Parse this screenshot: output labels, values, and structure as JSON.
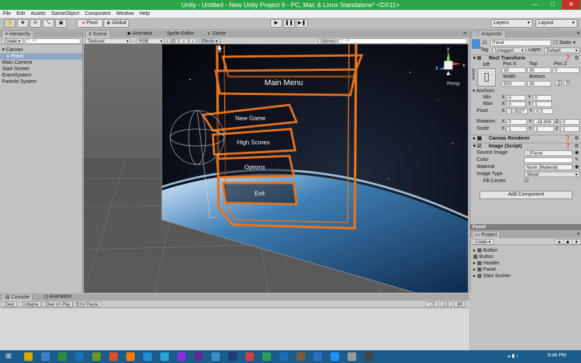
{
  "window": {
    "title": "Unity - Untitled - New Unity Project 9 - PC, Mac & Linux Standalone* <DX11>",
    "minimize": "—",
    "maximize": "□",
    "close": "✕"
  },
  "menu": [
    "File",
    "Edit",
    "Assets",
    "GameObject",
    "Component",
    "Window",
    "Help"
  ],
  "toolbar": {
    "pivot": "Pivot",
    "global": "Global",
    "play": "▶",
    "pause": "❚❚",
    "step": "▶❚",
    "layers": "Layers",
    "layout": "Layout"
  },
  "hierarchy": {
    "tab": "Hierarchy",
    "create": "Create",
    "search": "All",
    "items": [
      {
        "label": "Canvas",
        "indent": 0,
        "selected": false
      },
      {
        "label": "Panel",
        "indent": 1,
        "selected": true
      },
      {
        "label": "Main Camera",
        "indent": 0,
        "selected": false
      },
      {
        "label": "Start Screen",
        "indent": 0,
        "selected": false
      },
      {
        "label": "EventSystem",
        "indent": 0,
        "selected": false
      },
      {
        "label": "Particle System",
        "indent": 0,
        "selected": false
      }
    ]
  },
  "scene": {
    "tabs": [
      "Scene",
      "Animator",
      "Sprite Editor",
      "Game"
    ],
    "shading": "Textured",
    "render": "RGB",
    "mode2d": "2D",
    "effects": "Effects",
    "gizmos": "Gizmos",
    "search": "All",
    "persp": "Persp",
    "buttons": [
      "New Game",
      "High Scores",
      "Options",
      "Exit"
    ],
    "header": "Main Menu"
  },
  "inspector": {
    "tab": "Inspector",
    "object": "Panel",
    "static": "Static",
    "tag_label": "Tag",
    "tag": "Untagged",
    "layer_label": "Layer",
    "layer": "Default",
    "rect": {
      "title": "Rect Transform",
      "anchor_preset": "left",
      "stretch": "stretch",
      "posx_l": "Pos X",
      "top_l": "Top",
      "posz_l": "Pos Z",
      "posx": "30",
      "top": "30",
      "posz": "0",
      "width_l": "Width",
      "bottom_l": "Bottom",
      "width": "503",
      "bottom": "30",
      "anchors": "Anchors",
      "min": "Min",
      "max": "Max",
      "pivot": "Pivot",
      "xl": "X",
      "yl": "Y",
      "zl": "Z",
      "min_x": "0",
      "min_y": "0",
      "max_x": "0",
      "max_y": "1",
      "pivot_x": "-3.3527",
      "pivot_y": "0.5",
      "rotation": "Rotation",
      "rot_x": "0",
      "rot_y": "-18.909",
      "rot_z": "0",
      "scale": "Scale",
      "sc_x": "1",
      "sc_y": "1",
      "sc_z": "1",
      "r_btn": "R"
    },
    "canvas_renderer": "Canvas Renderer",
    "image": {
      "title": "Image (Script)",
      "source_l": "Source Image",
      "source": "Panel",
      "color_l": "Color",
      "material_l": "Material",
      "material": "None (Material)",
      "type_l": "Image Type",
      "type": "Sliced",
      "fill_l": "Fill Center"
    },
    "add_component": "Add Component",
    "preview": "Panel"
  },
  "project": {
    "tab": "Project",
    "create": "Create",
    "items": [
      "Button",
      "Button",
      "Header",
      "Panel",
      "Start Screen"
    ]
  },
  "console": {
    "tabs": [
      "Console",
      "Animation"
    ],
    "buttons": [
      "Clear",
      "Collapse",
      "Clear on Play",
      "Error Pause"
    ],
    "counts": [
      "0",
      "0",
      "0"
    ]
  },
  "taskbar": {
    "time": "9:46 PM"
  },
  "colors": {
    "titlebar": "#2ba548",
    "accent": "#e8731d",
    "selection": "#8ea7c8"
  }
}
